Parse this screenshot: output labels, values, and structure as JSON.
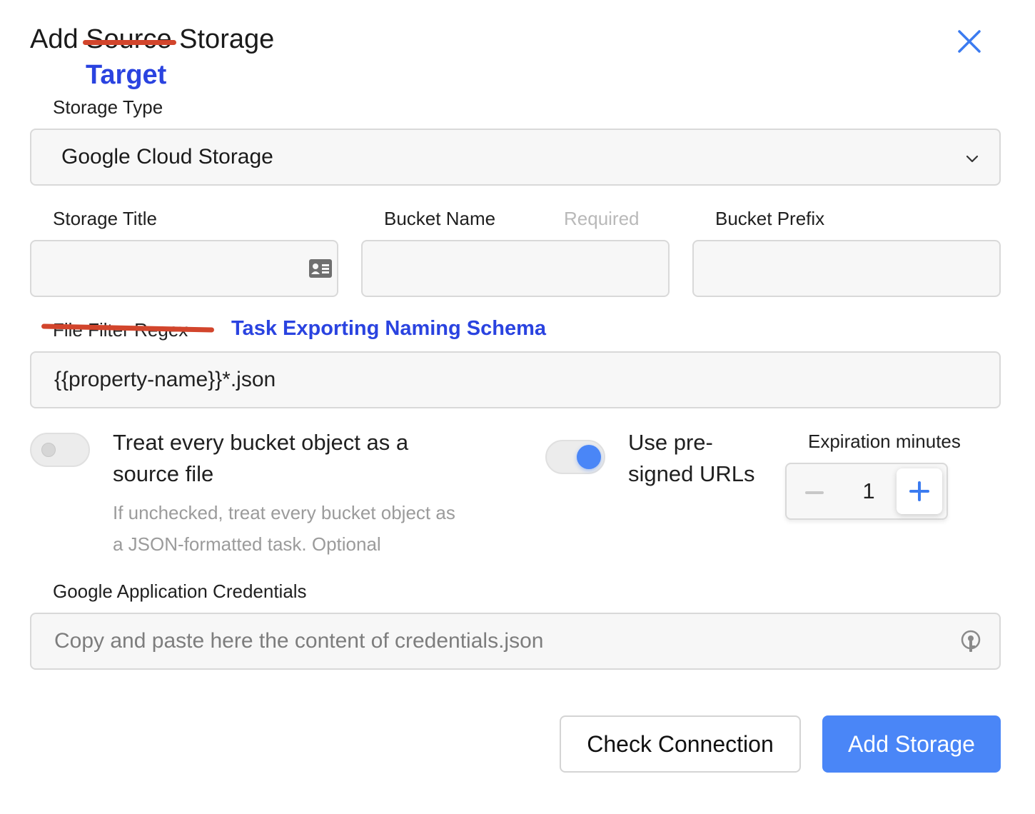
{
  "dialog": {
    "title_prefix": "Add",
    "title_struck": "Source",
    "title_suffix": "Storage",
    "annotation_target": "Target"
  },
  "storage_type": {
    "label": "Storage Type",
    "selected": "Google Cloud Storage"
  },
  "storage_title": {
    "label": "Storage Title",
    "value": ""
  },
  "bucket_name": {
    "label": "Bucket Name",
    "hint": "Required",
    "value": ""
  },
  "bucket_prefix": {
    "label": "Bucket Prefix",
    "value": ""
  },
  "file_filter": {
    "label_struck": "File Filter Regex",
    "annotation_label": "Task Exporting Naming Schema",
    "value": "{{property-name}}*.json"
  },
  "treat_objects": {
    "line1": "Treat every bucket object as a",
    "line2": "source file",
    "help_line1": "If unchecked, treat every bucket object as",
    "help_line2": "a JSON-formatted task. Optional",
    "checked": false
  },
  "presigned": {
    "line1": "Use pre-",
    "line2": "signed URLs",
    "checked": true
  },
  "expiration": {
    "label": "Expiration minutes",
    "value": "1"
  },
  "credentials": {
    "label": "Google Application Credentials",
    "placeholder": "Copy and paste here the content of credentials.json"
  },
  "actions": {
    "check_label": "Check Connection",
    "add_label": "Add Storage"
  },
  "colors": {
    "accent": "#4a86f7",
    "annotation_blue": "#2a43e0",
    "annotation_red": "#d2452c"
  }
}
